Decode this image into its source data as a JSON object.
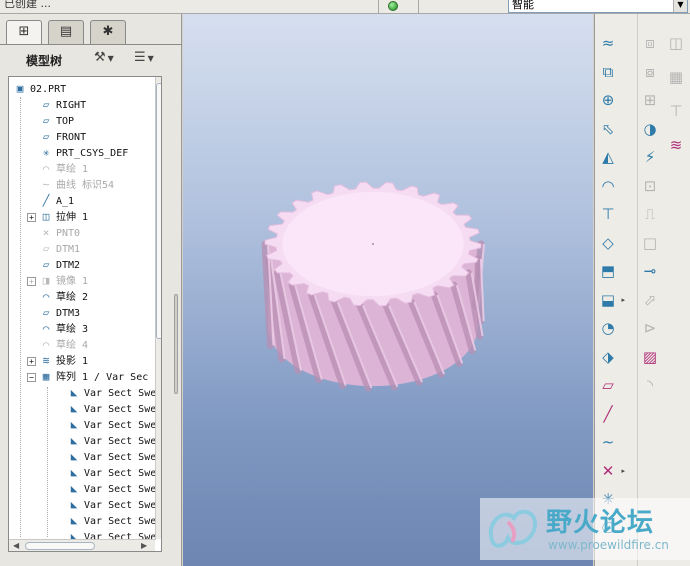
{
  "topbar": {
    "crumb": "已创建 ...",
    "filter_value": "智能"
  },
  "left_panel": {
    "tabs": [
      {
        "name": "model-tree-tab",
        "glyph": "⊞"
      },
      {
        "name": "folder-browser-tab",
        "glyph": "▤"
      },
      {
        "name": "favorites-tab",
        "glyph": "✱"
      }
    ],
    "title": "模型树",
    "settings_glyph": "⚒",
    "show_glyph": "☰"
  },
  "tree": {
    "items": [
      {
        "label": "02.PRT",
        "icon": "▣",
        "indent": 0,
        "dim": false,
        "expander": ""
      },
      {
        "label": "RIGHT",
        "icon": "▱",
        "indent": 1,
        "dim": false,
        "expander": ""
      },
      {
        "label": "TOP",
        "icon": "▱",
        "indent": 1,
        "dim": false,
        "expander": ""
      },
      {
        "label": "FRONT",
        "icon": "▱",
        "indent": 1,
        "dim": false,
        "expander": ""
      },
      {
        "label": "PRT_CSYS_DEF",
        "icon": "✳",
        "indent": 1,
        "dim": false,
        "expander": ""
      },
      {
        "label": "草绘 1",
        "icon": "⌒",
        "indent": 1,
        "dim": true,
        "expander": ""
      },
      {
        "label": "曲线 标识54",
        "icon": "∼",
        "indent": 1,
        "dim": true,
        "expander": ""
      },
      {
        "label": "A_1",
        "icon": "╱",
        "indent": 1,
        "dim": false,
        "expander": ""
      },
      {
        "label": "拉伸 1",
        "icon": "◫",
        "indent": 1,
        "dim": false,
        "expander": "+"
      },
      {
        "label": "PNT0",
        "icon": "×",
        "indent": 1,
        "dim": true,
        "expander": ""
      },
      {
        "label": "DTM1",
        "icon": "▱",
        "indent": 1,
        "dim": true,
        "expander": ""
      },
      {
        "label": "DTM2",
        "icon": "▱",
        "indent": 1,
        "dim": false,
        "expander": ""
      },
      {
        "label": "镜像 1",
        "icon": "◨",
        "indent": 1,
        "dim": true,
        "expander": "+"
      },
      {
        "label": "草绘 2",
        "icon": "⌒",
        "indent": 1,
        "dim": false,
        "expander": ""
      },
      {
        "label": "DTM3",
        "icon": "▱",
        "indent": 1,
        "dim": false,
        "expander": ""
      },
      {
        "label": "草绘 3",
        "icon": "⌒",
        "indent": 1,
        "dim": false,
        "expander": ""
      },
      {
        "label": "草绘 4",
        "icon": "⌒",
        "indent": 1,
        "dim": true,
        "expander": ""
      },
      {
        "label": "投影 1",
        "icon": "≋",
        "indent": 1,
        "dim": false,
        "expander": "+"
      },
      {
        "label": "阵列 1 / Var Sec",
        "icon": "▦",
        "indent": 1,
        "dim": false,
        "expander": "−"
      },
      {
        "label": "Var Sect Swe",
        "icon": "◣",
        "indent": 2,
        "dim": false,
        "expander": ""
      },
      {
        "label": "Var Sect Swe",
        "icon": "◣",
        "indent": 2,
        "dim": false,
        "expander": ""
      },
      {
        "label": "Var Sect Swe",
        "icon": "◣",
        "indent": 2,
        "dim": false,
        "expander": ""
      },
      {
        "label": "Var Sect Swe",
        "icon": "◣",
        "indent": 2,
        "dim": false,
        "expander": ""
      },
      {
        "label": "Var Sect Swe",
        "icon": "◣",
        "indent": 2,
        "dim": false,
        "expander": ""
      },
      {
        "label": "Var Sect Swe",
        "icon": "◣",
        "indent": 2,
        "dim": false,
        "expander": ""
      },
      {
        "label": "Var Sect Swe",
        "icon": "◣",
        "indent": 2,
        "dim": false,
        "expander": ""
      },
      {
        "label": "Var Sect Swe",
        "icon": "◣",
        "indent": 2,
        "dim": false,
        "expander": ""
      },
      {
        "label": "Var Sect Swe",
        "icon": "◣",
        "indent": 2,
        "dim": false,
        "expander": ""
      },
      {
        "label": "Var Sect Swe",
        "icon": "◣",
        "indent": 2,
        "dim": false,
        "expander": ""
      }
    ]
  },
  "model": {
    "teeth": 26,
    "face_color": "#f6dcf3",
    "side_color": "#dcb4d6",
    "helix_color": "#b98fb3"
  },
  "right_toolbar": {
    "col1": [
      {
        "name": "sketch-tool-icon",
        "glyph": "≈",
        "tone": "blue"
      },
      {
        "name": "datum-plane-icon",
        "glyph": "⧉",
        "tone": "blue"
      },
      {
        "name": "datum-axis-icon",
        "glyph": "⊕",
        "tone": "blue"
      },
      {
        "name": "datum-point-icon",
        "glyph": "⬁",
        "tone": "blue"
      },
      {
        "name": "extrude-icon",
        "glyph": "◭",
        "tone": "blue"
      },
      {
        "name": "revolve-icon",
        "glyph": "◠",
        "tone": "blue"
      },
      {
        "name": "sweep-icon",
        "glyph": "⊤",
        "tone": "blue"
      },
      {
        "name": "blend-icon",
        "glyph": "◇",
        "tone": "blue"
      },
      {
        "name": "hole-icon",
        "glyph": "⬒",
        "tone": "blue"
      },
      {
        "name": "shell-icon",
        "glyph": "⬓",
        "tone": "blue"
      },
      {
        "name": "rib-icon",
        "glyph": "◔",
        "tone": "blue"
      },
      {
        "name": "draft-icon",
        "glyph": "⬗",
        "tone": "blue"
      },
      {
        "name": "round-icon",
        "glyph": "▱",
        "tone": "mag"
      },
      {
        "name": "chamfer-icon",
        "glyph": "╱",
        "tone": "mag"
      },
      {
        "name": "curve-icon",
        "glyph": "∼",
        "tone": "blue"
      },
      {
        "name": "point-icon",
        "glyph": "✕",
        "tone": "mag"
      },
      {
        "name": "csys-icon",
        "glyph": "✳",
        "tone": "blue"
      },
      {
        "name": "analysis-icon",
        "glyph": "⎔",
        "tone": "blue"
      }
    ],
    "col2": [
      {
        "name": "copy-icon",
        "glyph": "⧈",
        "tone": "gray"
      },
      {
        "name": "paste-icon",
        "glyph": "⧇",
        "tone": "gray"
      },
      {
        "name": "pattern-icon",
        "glyph": "⊞",
        "tone": "gray"
      },
      {
        "name": "mirror-icon",
        "glyph": "◑",
        "tone": "blue"
      },
      {
        "name": "merge-icon",
        "glyph": "⚡",
        "tone": "blue"
      },
      {
        "name": "trim-icon",
        "glyph": "⊡",
        "tone": "gray"
      },
      {
        "name": "extend-icon",
        "glyph": "⎍",
        "tone": "gray"
      },
      {
        "name": "offset-icon",
        "glyph": "□",
        "tone": "gray"
      },
      {
        "name": "project-icon",
        "glyph": "⊸",
        "tone": "blue"
      },
      {
        "name": "thicken-icon",
        "glyph": "⬀",
        "tone": "gray"
      },
      {
        "name": "solidify-icon",
        "glyph": "⊳",
        "tone": "gray"
      },
      {
        "name": "wrap-icon",
        "glyph": "▨",
        "tone": "mag"
      },
      {
        "name": "intersect-icon",
        "glyph": "◝",
        "tone": "gray"
      }
    ],
    "col3": [
      {
        "name": "mirror-geom-icon",
        "glyph": "◫",
        "tone": "gray"
      },
      {
        "name": "table-icon",
        "glyph": "▦",
        "tone": "gray"
      },
      {
        "name": "surface-icon",
        "glyph": "⊤",
        "tone": "gray"
      },
      {
        "name": "style-icon",
        "glyph": "≋",
        "tone": "mag"
      }
    ]
  },
  "watermark": {
    "name": "野火论坛",
    "url": "www.proewildfire.cn"
  }
}
